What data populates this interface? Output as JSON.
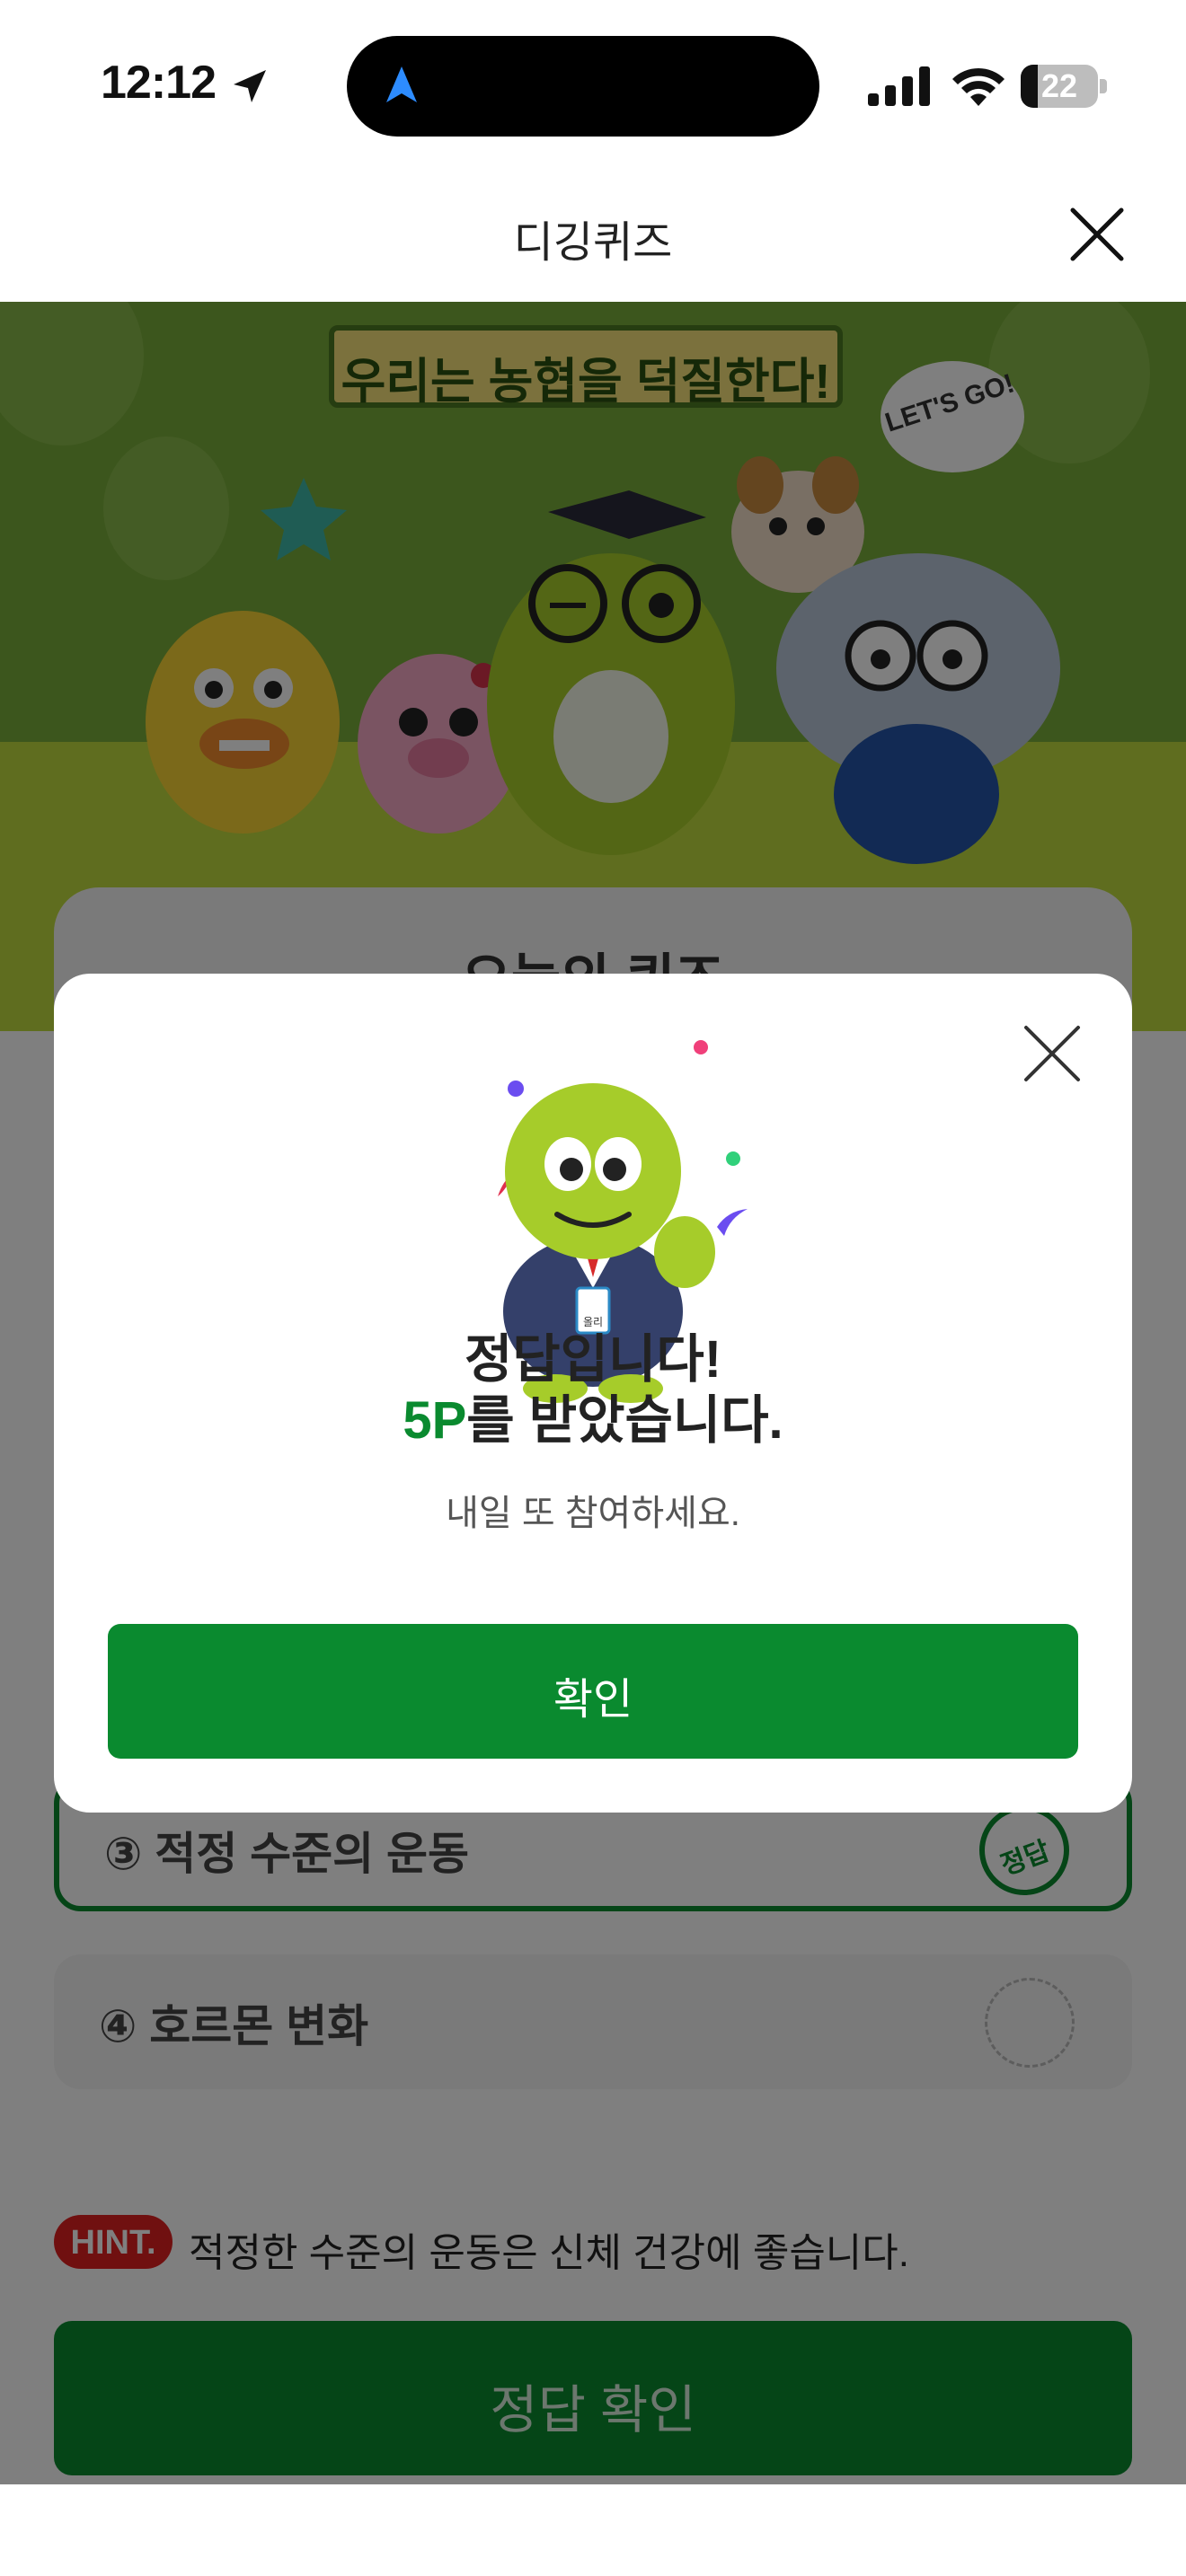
{
  "status_bar": {
    "time": "12:12",
    "battery": "22",
    "battery_level": 0.22,
    "icons": [
      "location-arrow-icon",
      "navigation-icon",
      "signal-icon",
      "wifi-icon",
      "battery-icon"
    ]
  },
  "header": {
    "title": "디깅퀴즈",
    "close_icon": "close-icon"
  },
  "hero": {
    "banner_text": "우리는 농협을 덕질한다!",
    "speech_bubble": "LET'S GO!"
  },
  "quiz": {
    "title_peek": "오늘의 퀴즈",
    "options": [
      {
        "label": "③ 적정 수준의 운동",
        "mark": "정답",
        "correct": true
      },
      {
        "label": "④ 호르몬 변화",
        "mark": "",
        "correct": false
      }
    ],
    "hint_badge": "HINT.",
    "hint_text": "적정한 수준의 운동은 신체 건강에 좋습니다.",
    "check_button": "정답 확인"
  },
  "modal": {
    "title": "정답입니다!",
    "reward_amount": "5P",
    "reward_suffix": "를 받았습니다.",
    "subtitle": "내일 또 참여하세요.",
    "confirm": "확인",
    "badge_name": "올리",
    "close_icon": "close-icon"
  },
  "colors": {
    "accent": "#0a8a2f",
    "hint_red": "#e02020",
    "hero_green": "#79ad3a",
    "hero_lime": "#bfdb3e"
  }
}
